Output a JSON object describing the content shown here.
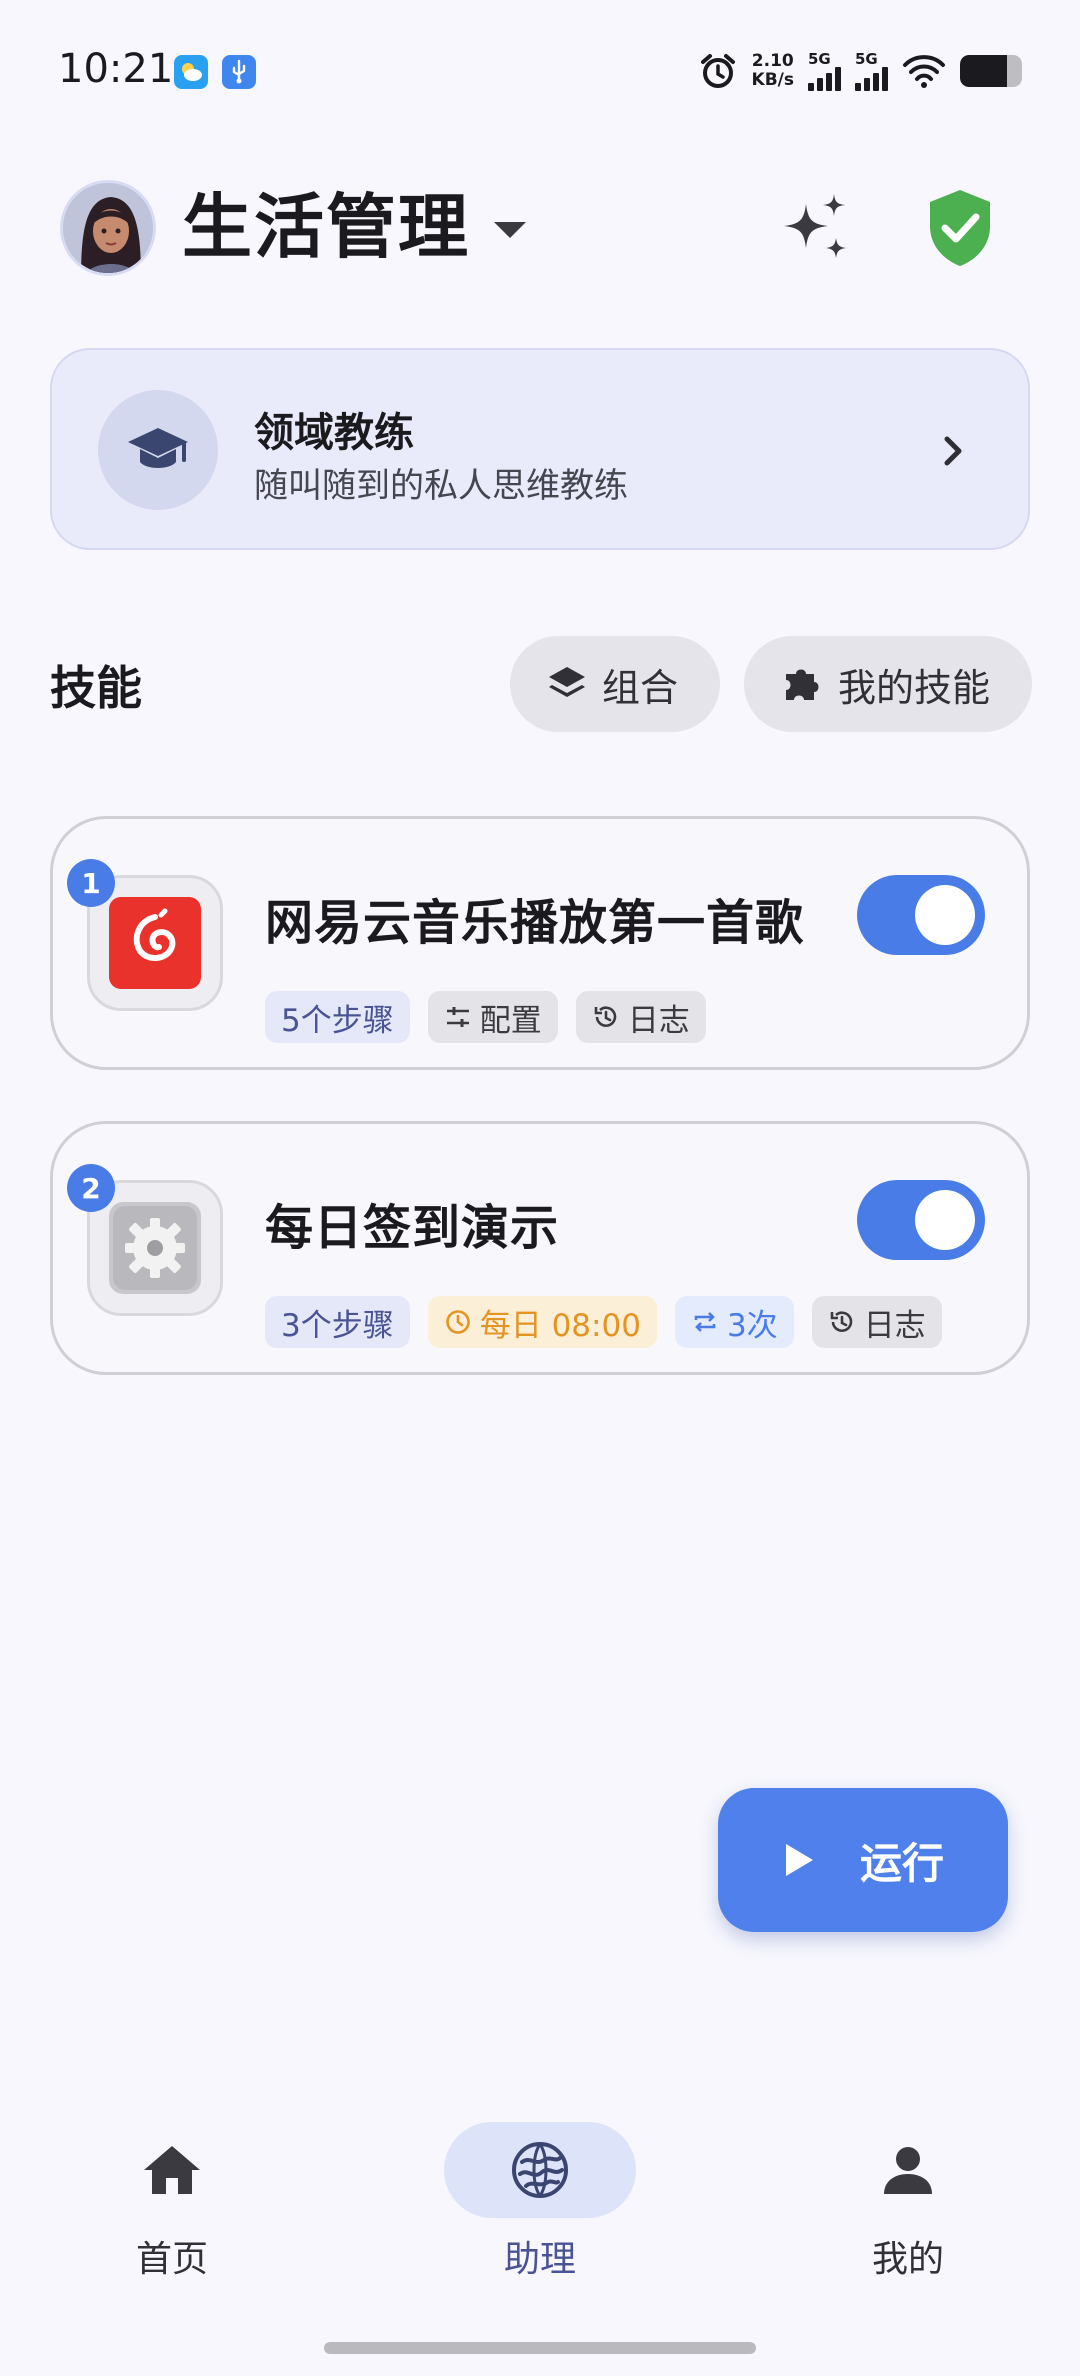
{
  "status_bar": {
    "time": "10:21",
    "net_speed_value": "2.10",
    "net_speed_unit": "KB/s",
    "sim1": "5G",
    "sim2": "5G",
    "battery_level": 0.75
  },
  "header": {
    "title": "生活管理"
  },
  "coach_card": {
    "title": "领域教练",
    "subtitle": "随叫随到的私人思维教练"
  },
  "skills": {
    "heading": "技能",
    "combine_label": "组合",
    "my_skills_label": "我的技能",
    "items": [
      {
        "index": "1",
        "title": "网易云音乐播放第一首歌",
        "enabled": true,
        "tags": {
          "steps": "5个步骤",
          "config": "配置",
          "log": "日志"
        }
      },
      {
        "index": "2",
        "title": "每日签到演示",
        "enabled": true,
        "tags": {
          "steps": "3个步骤",
          "schedule": "每日 08:00",
          "repeat": "3次",
          "log": "日志"
        }
      }
    ]
  },
  "run_button": {
    "label": "运行"
  },
  "bottom_nav": {
    "items": [
      {
        "label": "首页",
        "icon": "home-icon"
      },
      {
        "label": "助理",
        "icon": "assistant-icon"
      },
      {
        "label": "我的",
        "icon": "person-icon"
      }
    ],
    "active": "助理"
  },
  "colors": {
    "accent": "#4a7ce8",
    "background": "#f7f7fd",
    "coach_card_bg": "#e9ebfb",
    "shield_green": "#4caf50",
    "netease_red": "#e8322b",
    "schedule_orange": "#e39524"
  }
}
